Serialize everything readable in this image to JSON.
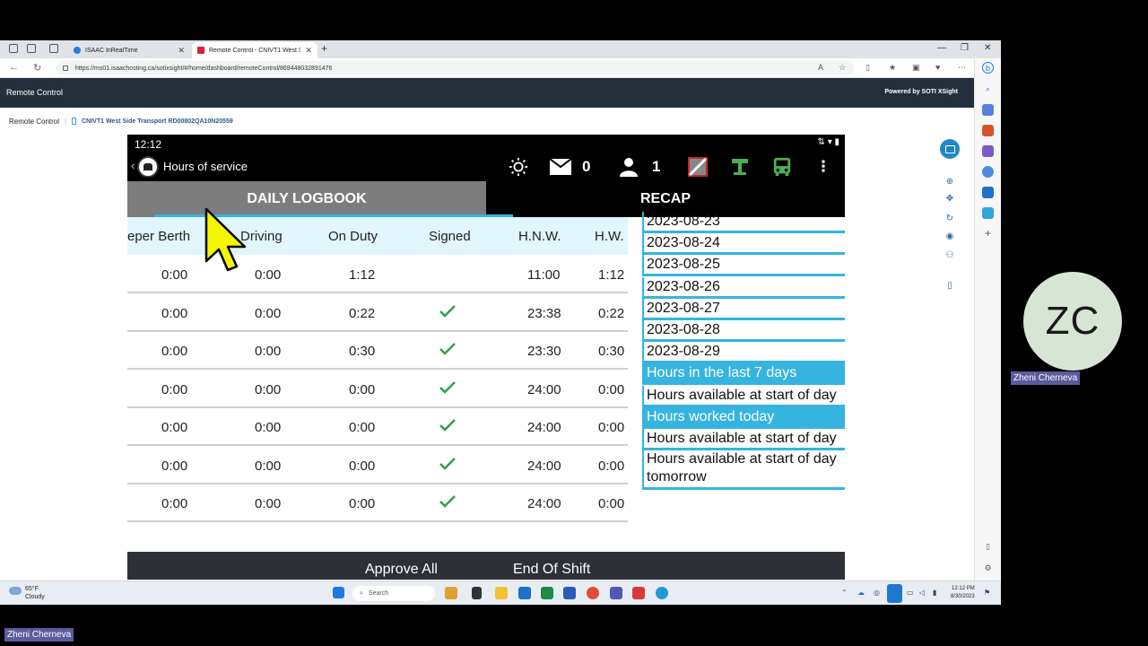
{
  "browser": {
    "tabs": [
      {
        "label": "ISAAC InRealTime",
        "active": false
      },
      {
        "label": "Remote Control - CNIVT1 West S",
        "active": true
      }
    ],
    "url": "https://ms01.isaachosting.ca/sotixsight/#/home/dashboard/remoteControl/869448032891476"
  },
  "page": {
    "header_title": "Remote Control",
    "powered_by": "Powered by SOTI XSight",
    "breadcrumb_root": "Remote Control",
    "breadcrumb_device": "CNIVT1 West Side Transport RD00802QA10N20559"
  },
  "device": {
    "time": "12:12",
    "app_title": "Hours of service",
    "mail_count": "0",
    "people_count": "1",
    "tabs": {
      "daily": "DAILY LOGBOOK",
      "recap": "RECAP"
    },
    "columns": [
      "eper Berth",
      "Driving",
      "On Duty",
      "Signed",
      "H.N.W.",
      "H.W."
    ],
    "rows": [
      {
        "sleeper": "0:00",
        "driving": "0:00",
        "on_duty": "1:12",
        "signed": false,
        "hnw": "11:00",
        "hw": "1:12"
      },
      {
        "sleeper": "0:00",
        "driving": "0:00",
        "on_duty": "0:22",
        "signed": true,
        "hnw": "23:38",
        "hw": "0:22"
      },
      {
        "sleeper": "0:00",
        "driving": "0:00",
        "on_duty": "0:30",
        "signed": true,
        "hnw": "23:30",
        "hw": "0:30"
      },
      {
        "sleeper": "0:00",
        "driving": "0:00",
        "on_duty": "0:00",
        "signed": true,
        "hnw": "24:00",
        "hw": "0:00"
      },
      {
        "sleeper": "0:00",
        "driving": "0:00",
        "on_duty": "0:00",
        "signed": true,
        "hnw": "24:00",
        "hw": "0:00"
      },
      {
        "sleeper": "0:00",
        "driving": "0:00",
        "on_duty": "0:00",
        "signed": true,
        "hnw": "24:00",
        "hw": "0:00"
      },
      {
        "sleeper": "0:00",
        "driving": "0:00",
        "on_duty": "0:00",
        "signed": true,
        "hnw": "24:00",
        "hw": "0:00"
      }
    ],
    "recap_list": [
      {
        "text": "2023-08-23",
        "highlight": false
      },
      {
        "text": "2023-08-24",
        "highlight": false
      },
      {
        "text": "2023-08-25",
        "highlight": false
      },
      {
        "text": "2023-08-26",
        "highlight": false
      },
      {
        "text": "2023-08-27",
        "highlight": false
      },
      {
        "text": "2023-08-28",
        "highlight": false
      },
      {
        "text": "2023-08-29",
        "highlight": false
      },
      {
        "text": "Hours in the last 7 days",
        "highlight": true
      },
      {
        "text": "Hours available at start of day",
        "highlight": false
      },
      {
        "text": "Hours worked today",
        "highlight": true
      },
      {
        "text": "Hours available at start of day",
        "highlight": false
      },
      {
        "text": "Hours available at start of day tomorrow",
        "highlight": false
      }
    ],
    "actions": {
      "approve_all": "Approve All",
      "end_of_shift": "End Of Shift"
    }
  },
  "taskbar": {
    "temperature": "65°F",
    "weather": "Cloudy",
    "search_placeholder": "Search",
    "time": "12:12 PM",
    "date": "8/30/2023"
  },
  "meeting": {
    "initials": "ZC",
    "participant_name": "Zheni Cherneva",
    "self_name": "Zheni Cherneva"
  },
  "colors": {
    "accent": "#35b4e0",
    "header": "#232f3b",
    "name_chip": "#5b5c9c"
  }
}
